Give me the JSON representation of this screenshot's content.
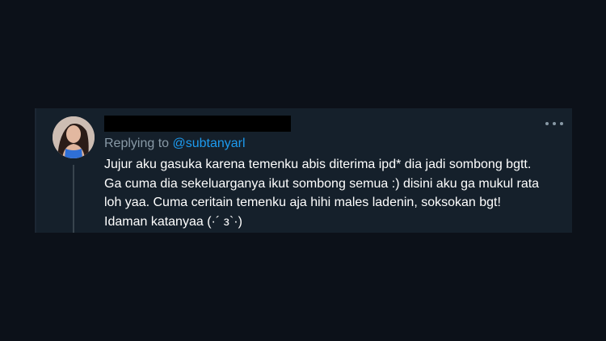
{
  "tweet": {
    "replying_prefix": "Replying to",
    "replying_handle": "@subtanyarl",
    "text": "Jujur aku gasuka karena temenku abis diterima ipd* dia jadi sombong bgtt. Ga cuma dia sekeluarganya ikut sombong semua :) disini aku ga mukul rata loh yaa. Cuma ceritain temenku aja hihi males ladenin, soksokan bgt! Idaman katanyaa (·´ з`·)",
    "more_icon": "more-horizontal-icon"
  },
  "colors": {
    "page_background": "#0c1119",
    "card_background": "#15202b",
    "text_primary": "#ffffff",
    "text_secondary": "#8899a6",
    "accent": "#1d9bf0"
  }
}
